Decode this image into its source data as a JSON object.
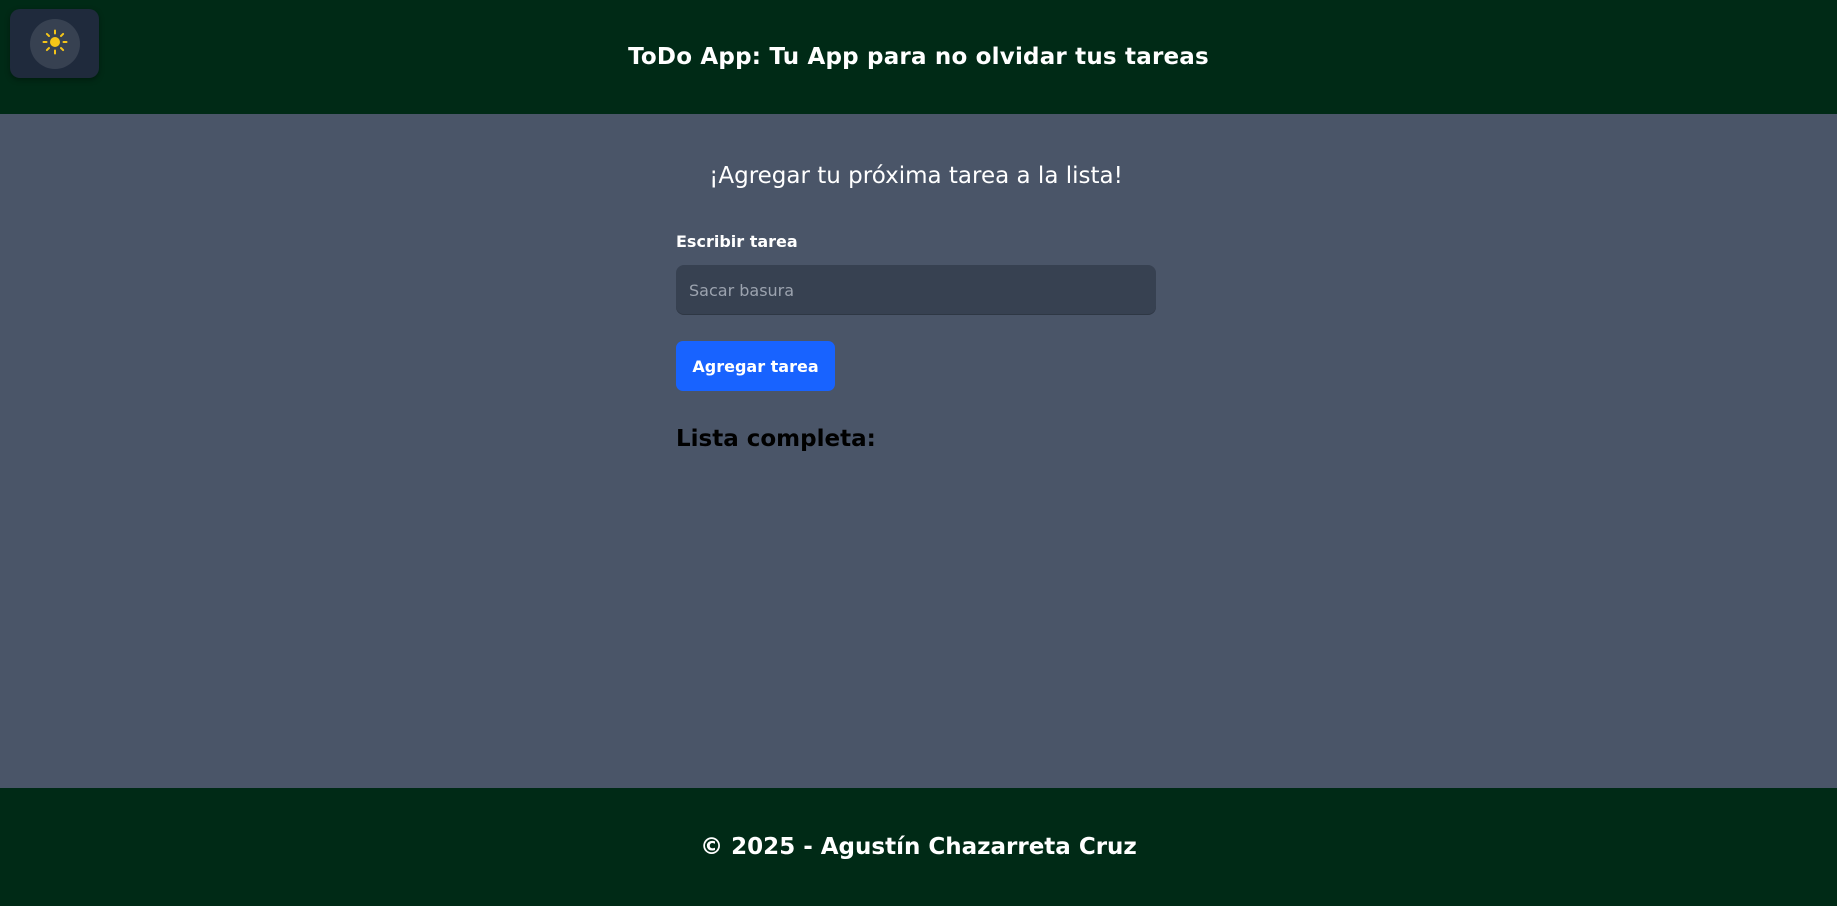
{
  "header": {
    "title": "ToDo App: Tu App para no olvidar tus tareas",
    "theme_toggle_icon": "sun-icon"
  },
  "main": {
    "subtitle": "¡Agregar tu próxima tarea a la lista!",
    "input_label": "Escribir tarea",
    "input_placeholder": "Sacar basura",
    "input_value": "",
    "add_button_label": "Agregar tarea",
    "list_title": "Lista completa:",
    "tasks": []
  },
  "footer": {
    "text": "© 2025 - Agustín Chazarreta Cruz"
  },
  "colors": {
    "header_bg": "#002a16",
    "main_bg": "#4a5568",
    "input_bg": "#374151",
    "button_bg": "#1863ff",
    "sun_icon": "#f5c518"
  }
}
